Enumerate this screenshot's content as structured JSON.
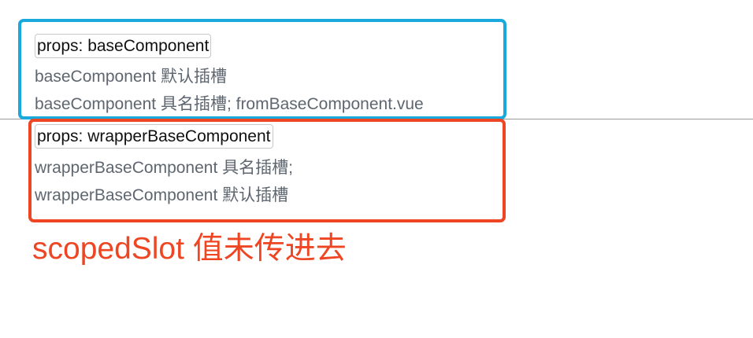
{
  "base": {
    "props_label": "props: baseComponent",
    "default_slot": "baseComponent 默认插槽",
    "named_slot": "baseComponent 具名插槽; fromBaseComponent.vue",
    "frame_color": "#1aa9dd"
  },
  "wrapper": {
    "props_label": "props: wrapperBaseComponent",
    "named_slot": "wrapperBaseComponent 具名插槽;",
    "default_slot": "wrapperBaseComponent 默认插槽",
    "frame_color": "#ee4523"
  },
  "annotation": {
    "text": "scopedSlot 值未传进去",
    "color": "#ee4523"
  }
}
